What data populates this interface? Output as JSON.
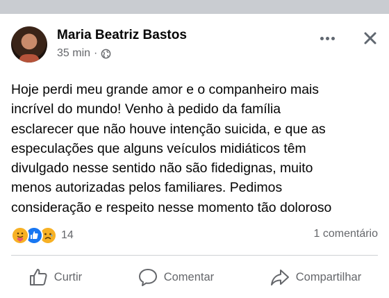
{
  "post": {
    "author": "Maria Beatriz Bastos",
    "time": "35 min",
    "separator": "·",
    "body_lines": [
      "Hoje perdi meu grande amor e o companheiro mais",
      "incrível do mundo! Venho à pedido da família",
      "esclarecer que não houve intenção suicida, e que as",
      "especulações  que alguns veículos midiáticos têm",
      "divulgado  nesse sentido não são fidedignas, muito",
      "menos autorizadas pelos familiares. Pedimos",
      "consideração e respeito nesse momento tão doloroso"
    ],
    "reaction_icons": [
      "care-emoji-icon",
      "like-icon",
      "sad-emoji-icon"
    ],
    "reaction_count": "14",
    "comments_label": "1 comentário"
  },
  "actions": {
    "like_label": "Curtir",
    "comment_label": "Comentar",
    "share_label": "Compartilhar"
  },
  "icons": {
    "privacy": "globe-icon",
    "more": "more-options-icon",
    "close": "close-icon"
  },
  "colors": {
    "like_blue": "#1877f2",
    "reaction_yellow": "#f7b125",
    "secondary_text": "#65676b"
  }
}
